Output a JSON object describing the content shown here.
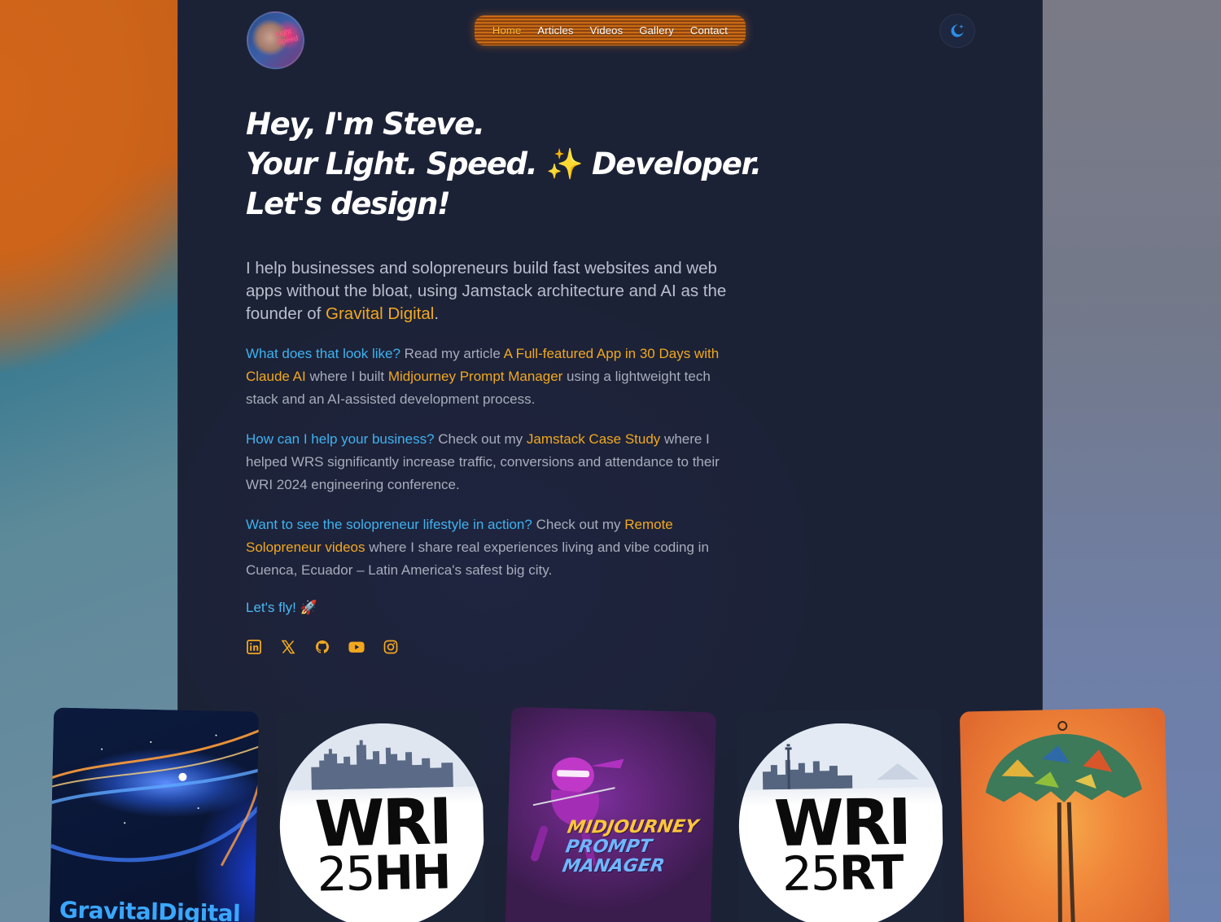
{
  "nav": {
    "items": [
      {
        "label": "Home",
        "active": true
      },
      {
        "label": "Articles",
        "active": false
      },
      {
        "label": "Videos",
        "active": false
      },
      {
        "label": "Gallery",
        "active": false
      },
      {
        "label": "Contact",
        "active": false
      }
    ]
  },
  "avatar": {
    "neon_text": "Light Speed"
  },
  "theme_toggle": {
    "icon": "moon-star-icon"
  },
  "hero": {
    "line1": "Hey, I'm Steve.",
    "line2a": "Your Light. Speed.",
    "line2_emoji": "✨",
    "line2b": "Developer.",
    "line3": "Let's design!"
  },
  "lead": {
    "text": "I help businesses and solopreneurs build fast websites and web apps without the bloat, using Jamstack architecture and AI as the founder of ",
    "link": "Gravital Digital",
    "end": "."
  },
  "para1": {
    "question": "What does that look like?",
    "t1": " Read my article ",
    "link1": "A Full-featured App in 30 Days with Claude AI",
    "t2": " where I built ",
    "link2": "Midjourney Prompt Manager",
    "t3": " using a lightweight tech stack and an AI-assisted development process."
  },
  "para2": {
    "question": "How can I help your business?",
    "t1": " Check out my ",
    "link1": "Jamstack Case Study",
    "t2": " where I helped WRS significantly increase traffic, conversions and attendance to their WRI 2024 engineering conference."
  },
  "para3": {
    "question": "Want to see the solopreneur lifestyle in action?",
    "t1": " Check out my ",
    "link1": "Remote Solopreneur videos",
    "t2": " where I share real experiences living and vibe coding in Cuenca, Ecuador – Latin America's safest big city."
  },
  "letsfly": {
    "text": "Let's fly!",
    "emoji": "🚀"
  },
  "socials": [
    "linkedin-icon",
    "x-icon",
    "github-icon",
    "youtube-icon",
    "instagram-icon"
  ],
  "colors": {
    "accent": "#f2a81e",
    "question": "#3fb2f0",
    "panel": "#1c2236"
  },
  "cards": {
    "gravital": {
      "text_a": "Gravital",
      "text_b": "Digital"
    },
    "wri_hh": {
      "big": "WRI",
      "num": "25",
      "suffix": "HH"
    },
    "mj": {
      "line1": "MIDJOURNEY",
      "line2": "PROMPT MANAGER"
    },
    "wri_rt": {
      "big": "WRI",
      "num": "25",
      "suffix": "RT"
    }
  }
}
